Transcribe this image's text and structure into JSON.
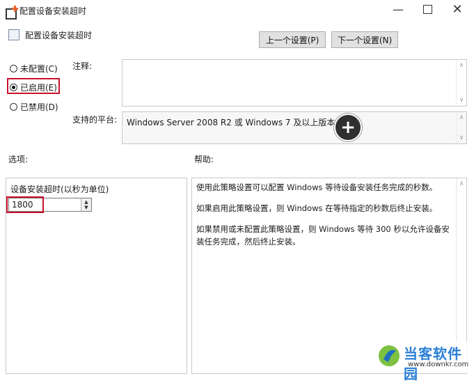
{
  "window": {
    "title": "配置设备安装超时",
    "minimize_icon": "minimize-icon",
    "maximize_icon": "maximize-icon",
    "close_icon": "close-icon"
  },
  "header": {
    "policy_name": "配置设备安装超时",
    "prev_button": "上一个设置(P)",
    "next_button": "下一个设置(N)"
  },
  "state": {
    "options": [
      {
        "label": "未配置(C)",
        "selected": false
      },
      {
        "label": "已启用(E)",
        "selected": true
      },
      {
        "label": "已禁用(D)",
        "selected": false
      }
    ]
  },
  "comment": {
    "label": "注释:",
    "value": ""
  },
  "platform": {
    "label": "支持的平台:",
    "value": "Windows Server 2008 R2 或 Windows 7 及以上版本"
  },
  "options_panel": {
    "heading": "选项:",
    "field_label": "设备安装超时(以秒为单位)",
    "field_value": "1800"
  },
  "help_panel": {
    "heading": "帮助:",
    "paragraphs": [
      "使用此策略设置可以配置 Windows 等待设备安装任务完成的秒数。",
      "如果启用此策略设置，则 Windows 在等待指定的秒数后终止安装。",
      "如果禁用或未配置此策略设置，则 Windows 等待 300 秒以允许设备安装任务完成，然后终止安装。"
    ]
  },
  "watermark": {
    "brand": "当客软件园",
    "url": "www.downkr.com"
  },
  "colors": {
    "highlight": "#c8102e",
    "button_bg": "#e1e1e1",
    "border": "#c8c8c8"
  }
}
